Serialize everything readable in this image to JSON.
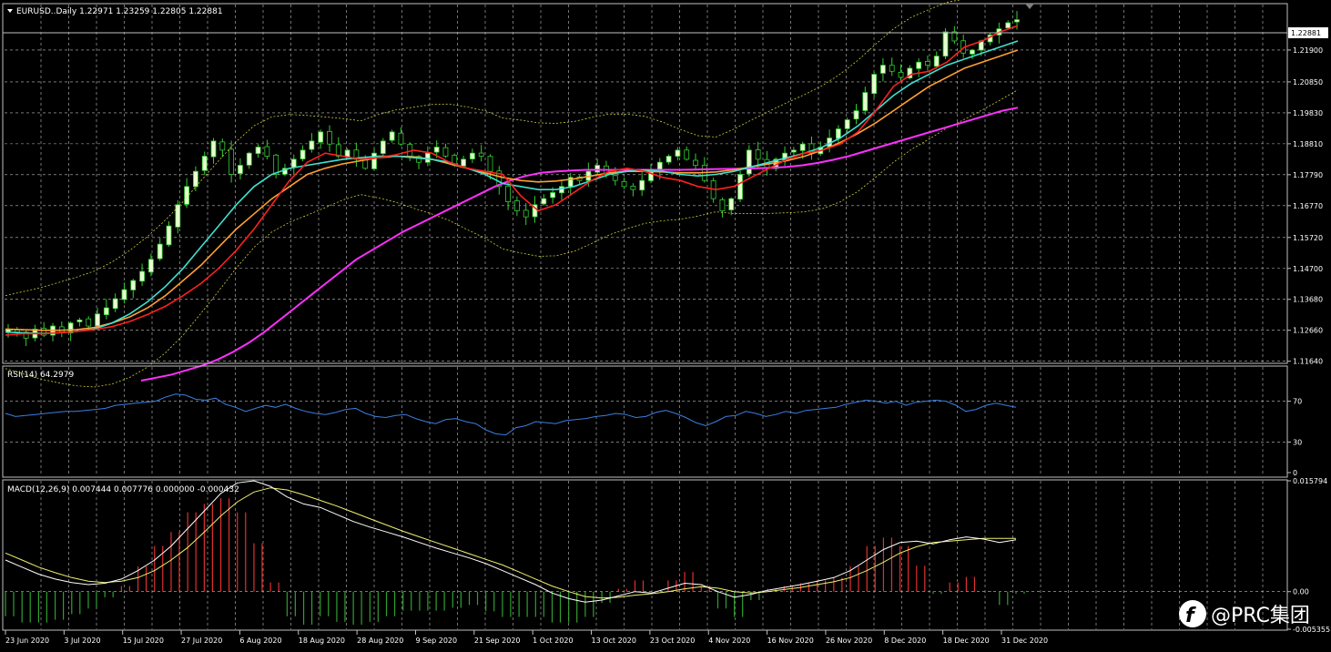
{
  "main": {
    "title": "EURUSD..Daily  1.22971 1.23259 1.22805 1.22881",
    "current_price_label": "1.22881",
    "price_ticks": [
      "1.21900",
      "1.20850",
      "1.19830",
      "1.18810",
      "1.17790",
      "1.16770",
      "1.15720",
      "1.14700",
      "1.13680",
      "1.12660",
      "1.11640"
    ]
  },
  "rsi": {
    "title": "RSI(14) 64.2979",
    "level_labels": [
      "70",
      "30",
      "0"
    ]
  },
  "macd": {
    "title": "MACD(12,26,9) 0.007444 0.007776 0.000000 -0.000432",
    "level_labels": [
      "0.015794",
      "0.00",
      "-0.005355"
    ]
  },
  "date_labels": [
    "23 Jun 2020",
    "3 Jul 2020",
    "15 Jul 2020",
    "27 Jul 2020",
    "6 Aug 2020",
    "18 Aug 2020",
    "28 Aug 2020",
    "9 Sep 2020",
    "21 Sep 2020",
    "1 Oct 2020",
    "13 Oct 2020",
    "23 Oct 2020",
    "4 Nov 2020",
    "16 Nov 2020",
    "26 Nov 2020",
    "8 Dec 2020",
    "18 Dec 2020",
    "31 Dec 2020"
  ],
  "watermark": "@PRC集团",
  "colors": {
    "background": "#000000",
    "grid": "#c0c0c0",
    "candle_up": "#32cd32",
    "candle_up_fill": "#e8ffd0",
    "candle_down": "#32cd32",
    "ma_fast": "#ff2020",
    "ma_mid": "#40e0d0",
    "ma_slow": "#ffa030",
    "ma_long": "#ff30ff",
    "bollinger": "#e8e840",
    "rsi": "#3a7fe0",
    "macd_main": "#ffffff",
    "macd_signal": "#f0f070",
    "hist_positive": "#e03030",
    "hist_negative": "#30a030"
  },
  "chart_data": [
    {
      "type": "candlestick",
      "symbol": "EURUSD",
      "timeframe": "Daily",
      "last": {
        "open": 1.22971,
        "high": 1.23259,
        "low": 1.22805,
        "close": 1.22881
      },
      "ylim": [
        1.116,
        1.234
      ],
      "close_series": [
        1.127,
        1.126,
        1.124,
        1.127,
        1.125,
        1.128,
        1.126,
        1.129,
        1.13,
        1.128,
        1.132,
        1.134,
        1.137,
        1.14,
        1.143,
        1.146,
        1.15,
        1.155,
        1.161,
        1.168,
        1.174,
        1.179,
        1.184,
        1.189,
        1.186,
        1.178,
        1.181,
        1.185,
        1.187,
        1.184,
        1.178,
        1.18,
        1.183,
        1.186,
        1.189,
        1.192,
        1.188,
        1.184,
        1.186,
        1.183,
        1.18,
        1.185,
        1.189,
        1.192,
        1.188,
        1.184,
        1.182,
        1.185,
        1.187,
        1.184,
        1.181,
        1.183,
        1.185,
        1.184,
        1.179,
        1.174,
        1.169,
        1.166,
        1.164,
        1.168,
        1.17,
        1.172,
        1.174,
        1.177,
        1.176,
        1.179,
        1.181,
        1.178,
        1.176,
        1.174,
        1.173,
        1.176,
        1.179,
        1.182,
        1.184,
        1.186,
        1.183,
        1.181,
        1.176,
        1.17,
        1.166,
        1.17,
        1.178,
        1.186,
        1.183,
        1.18,
        1.183,
        1.185,
        1.186,
        1.188,
        1.185,
        1.187,
        1.19,
        1.193,
        1.196,
        1.199,
        1.205,
        1.211,
        1.214,
        1.212,
        1.21,
        1.213,
        1.215,
        1.214,
        1.217,
        1.225,
        1.222,
        1.218,
        1.219,
        1.222,
        1.224,
        1.226,
        1.228,
        1.229
      ],
      "ma_fast_series": [
        1.125,
        1.1255,
        1.1255,
        1.1258,
        1.1262,
        1.1268,
        1.1278,
        1.1295,
        1.1318,
        1.1345,
        1.138,
        1.142,
        1.147,
        1.153,
        1.16,
        1.168,
        1.176,
        1.182,
        1.185,
        1.184,
        1.183,
        1.1835,
        1.1845,
        1.186,
        1.185,
        1.182,
        1.18,
        1.179,
        1.178,
        1.171,
        1.166,
        1.168,
        1.172,
        1.176,
        1.179,
        1.18,
        1.179,
        1.177,
        1.176,
        1.174,
        1.173,
        1.174,
        1.177,
        1.18,
        1.183,
        1.185,
        1.186,
        1.188,
        1.192,
        1.199,
        1.207,
        1.211,
        1.212,
        1.215,
        1.22,
        1.222,
        1.225,
        1.227
      ],
      "ma_mid_series": [
        1.126,
        1.1258,
        1.1256,
        1.1258,
        1.1262,
        1.127,
        1.129,
        1.132,
        1.136,
        1.141,
        1.147,
        1.154,
        1.161,
        1.168,
        1.174,
        1.178,
        1.18,
        1.181,
        1.182,
        1.183,
        1.1835,
        1.184,
        1.184,
        1.1835,
        1.183,
        1.182,
        1.18,
        1.178,
        1.175,
        1.174,
        1.173,
        1.173,
        1.174,
        1.176,
        1.178,
        1.179,
        1.1795,
        1.179,
        1.178,
        1.1775,
        1.178,
        1.179,
        1.1805,
        1.182,
        1.1835,
        1.185,
        1.187,
        1.19,
        1.194,
        1.199,
        1.204,
        1.208,
        1.211,
        1.214,
        1.216,
        1.218,
        1.22,
        1.222
      ],
      "ma_slow_series": [
        1.127,
        1.1268,
        1.1266,
        1.1266,
        1.1268,
        1.1275,
        1.129,
        1.131,
        1.134,
        1.138,
        1.143,
        1.148,
        1.154,
        1.16,
        1.165,
        1.17,
        1.174,
        1.178,
        1.18,
        1.1815,
        1.1825,
        1.1835,
        1.184,
        1.1838,
        1.183,
        1.1815,
        1.18,
        1.1785,
        1.177,
        1.176,
        1.1755,
        1.1758,
        1.1765,
        1.1775,
        1.1785,
        1.179,
        1.179,
        1.1788,
        1.1785,
        1.1785,
        1.1788,
        1.1795,
        1.1805,
        1.1815,
        1.1825,
        1.184,
        1.186,
        1.1885,
        1.1915,
        1.195,
        1.199,
        1.203,
        1.207,
        1.21,
        1.213,
        1.215,
        1.217,
        1.219
      ],
      "ma_long_series": [
        1.11,
        1.111,
        1.112,
        1.1135,
        1.115,
        1.117,
        1.1195,
        1.1225,
        1.126,
        1.13,
        1.134,
        1.138,
        1.142,
        1.146,
        1.15,
        1.153,
        1.156,
        1.159,
        1.1615,
        1.164,
        1.1665,
        1.169,
        1.1715,
        1.174,
        1.176,
        1.1775,
        1.1785,
        1.179,
        1.1793,
        1.1795,
        1.1795,
        1.1795,
        1.1795,
        1.1795,
        1.1795,
        1.1795,
        1.1796,
        1.1797,
        1.1798,
        1.1799,
        1.18,
        1.1802,
        1.1805,
        1.181,
        1.1818,
        1.1828,
        1.184,
        1.1855,
        1.187,
        1.1885,
        1.19,
        1.1915,
        1.193,
        1.1945,
        1.196,
        1.1975,
        1.199,
        1.2
      ]
    },
    {
      "type": "line",
      "name": "RSI(14)",
      "ylim": [
        0,
        100
      ],
      "levels": [
        70,
        30,
        0
      ],
      "values": [
        58,
        55,
        56,
        57,
        58,
        59,
        60,
        60,
        61,
        62,
        63,
        66,
        67,
        68,
        69,
        70,
        74,
        77,
        76,
        72,
        71,
        73,
        67,
        64,
        60,
        63,
        66,
        64,
        67,
        63,
        60,
        58,
        57,
        59,
        62,
        63,
        58,
        55,
        54,
        56,
        57,
        53,
        50,
        48,
        52,
        53,
        50,
        48,
        42,
        38,
        37,
        44,
        46,
        50,
        49,
        48,
        51,
        52,
        53,
        55,
        56,
        58,
        57,
        54,
        55,
        59,
        61,
        58,
        54,
        49,
        46,
        50,
        55,
        56,
        60,
        58,
        55,
        57,
        60,
        58,
        61,
        62,
        63,
        64,
        67,
        69,
        71,
        70,
        68,
        70,
        66,
        69,
        70,
        71,
        70,
        66,
        60,
        62,
        66,
        68,
        66,
        64
      ]
    },
    {
      "type": "line",
      "name": "MACD(12,26,9)",
      "ylim": [
        -0.005355,
        0.015794
      ],
      "main": [
        0.0045,
        0.0035,
        0.0025,
        0.0018,
        0.0013,
        0.001,
        0.0012,
        0.0018,
        0.003,
        0.0045,
        0.0065,
        0.009,
        0.0115,
        0.014,
        0.0155,
        0.0158,
        0.015,
        0.0135,
        0.0125,
        0.012,
        0.011,
        0.01,
        0.0092,
        0.0085,
        0.0078,
        0.007,
        0.0062,
        0.0055,
        0.0048,
        0.004,
        0.003,
        0.002,
        0.001,
        -0.0002,
        -0.001,
        -0.0015,
        -0.0012,
        -0.0006,
        0.0,
        -0.0002,
        0.0005,
        0.0012,
        0.001,
        0.0,
        -0.0008,
        -0.0004,
        0.0002,
        0.0006,
        0.001,
        0.0015,
        0.002,
        0.003,
        0.0045,
        0.006,
        0.007,
        0.0072,
        0.0068,
        0.0074,
        0.0078,
        0.0075,
        0.007,
        0.0074
      ],
      "signal": [
        0.0055,
        0.0045,
        0.0035,
        0.0027,
        0.002,
        0.0015,
        0.0013,
        0.0015,
        0.002,
        0.003,
        0.0045,
        0.0063,
        0.0085,
        0.0108,
        0.0128,
        0.0142,
        0.0148,
        0.0145,
        0.0138,
        0.013,
        0.0122,
        0.0113,
        0.0104,
        0.0095,
        0.0086,
        0.0078,
        0.007,
        0.0062,
        0.0054,
        0.0046,
        0.0038,
        0.0028,
        0.0018,
        0.0008,
        0.0,
        -0.0007,
        -0.0009,
        -0.0008,
        -0.0005,
        -0.0003,
        0.0,
        0.0004,
        0.0007,
        0.0005,
        0.0,
        -0.0002,
        0.0,
        0.0003,
        0.0006,
        0.001,
        0.0014,
        0.002,
        0.003,
        0.0042,
        0.0055,
        0.0064,
        0.007,
        0.0072,
        0.0074,
        0.0076,
        0.0076,
        0.0076
      ]
    }
  ]
}
